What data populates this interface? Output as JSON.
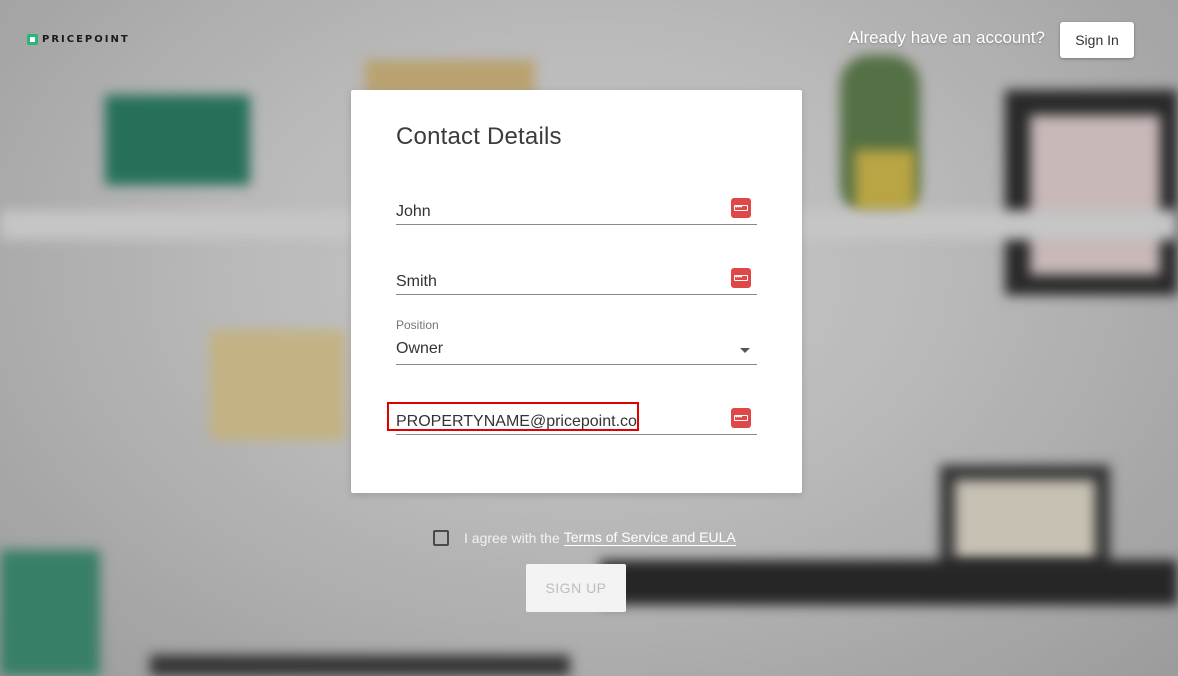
{
  "header": {
    "brand": "PRICEPOINT",
    "have_account": "Already have an account?",
    "signin_label": "Sign In"
  },
  "form": {
    "title": "Contact Details",
    "first_name": {
      "value": "John"
    },
    "last_name": {
      "value": "Smith"
    },
    "position": {
      "label": "Position",
      "value": "Owner"
    },
    "email": {
      "value": "PROPERTYNAME@pricepoint.co"
    }
  },
  "agreement": {
    "text": "I agree with the",
    "link": "Terms of Service and EULA",
    "checked": false
  },
  "signup_label": "SIGN UP",
  "colors": {
    "accent_red": "#e04848",
    "brand_green": "#2bb673",
    "highlight_red": "#e00000"
  },
  "icons": [
    "password-manager-icon",
    "dropdown-caret-icon",
    "checkbox-icon",
    "pricepoint-logo-icon"
  ]
}
